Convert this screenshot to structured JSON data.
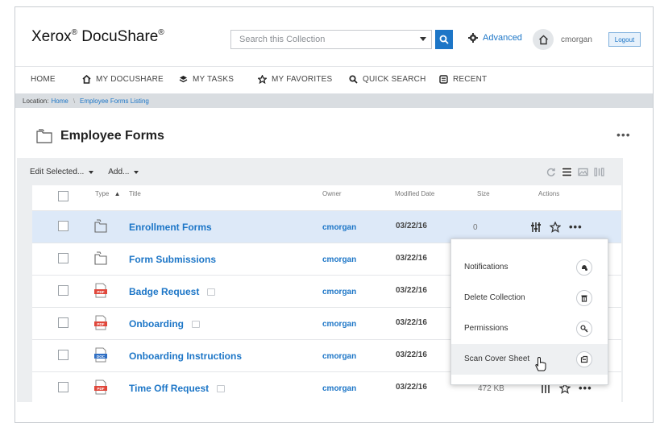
{
  "brand": {
    "name": "Xerox",
    "reg1": "®",
    "product": " DocuShare",
    "reg2": "®"
  },
  "search": {
    "placeholder": "Search this Collection",
    "advanced_label": "Advanced"
  },
  "user": {
    "name": "cmorgan",
    "logout_label": "Logout"
  },
  "nav": {
    "items": [
      {
        "label": "HOME",
        "icon": ""
      },
      {
        "label": "MY DOCUSHARE",
        "icon": "home-icon"
      },
      {
        "label": "MY TASKS",
        "icon": "layers-icon"
      },
      {
        "label": "MY FAVORITES",
        "icon": "star-icon"
      },
      {
        "label": "QUICK SEARCH",
        "icon": "search-icon"
      },
      {
        "label": "RECENT",
        "icon": "list-icon"
      }
    ]
  },
  "breadcrumb": {
    "prefix": "Location:",
    "home": "Home",
    "sep": "\\",
    "current": "Employee Forms Listing"
  },
  "page": {
    "title": "Employee Forms",
    "more": "•••"
  },
  "toolbar": {
    "edit_selected": "Edit Selected...",
    "add": "Add..."
  },
  "columns": {
    "type": "Type",
    "sort_arrow": "▲",
    "title": "Title",
    "owner": "Owner",
    "modified": "Modified Date",
    "size": "Size",
    "actions": "Actions"
  },
  "rows": [
    {
      "type": "folder",
      "title": "Enrollment Forms",
      "owner": "cmorgan",
      "date": "03/22/16",
      "size": "0",
      "copy": false,
      "selected": true
    },
    {
      "type": "folder",
      "title": "Form Submissions",
      "owner": "cmorgan",
      "date": "03/22/16",
      "size": "",
      "copy": false,
      "selected": false
    },
    {
      "type": "pdf",
      "title": "Badge Request",
      "owner": "cmorgan",
      "date": "03/22/16",
      "size": "",
      "copy": true,
      "selected": false
    },
    {
      "type": "pdf",
      "title": "Onboarding",
      "owner": "cmorgan",
      "date": "03/22/16",
      "size": "",
      "copy": true,
      "selected": false
    },
    {
      "type": "doc",
      "title": "Onboarding Instructions",
      "owner": "cmorgan",
      "date": "03/22/16",
      "size": "",
      "copy": false,
      "selected": false
    },
    {
      "type": "pdf",
      "title": "Time Off Request",
      "owner": "cmorgan",
      "date": "03/22/16",
      "size": "472 KB",
      "copy": true,
      "selected": false
    }
  ],
  "actions_menu": {
    "items": [
      {
        "label": "Notifications",
        "icon": "bell-icon"
      },
      {
        "label": "Delete Collection",
        "icon": "trash-icon"
      },
      {
        "label": "Permissions",
        "icon": "key-icon"
      },
      {
        "label": "Scan Cover Sheet",
        "icon": "scan-icon"
      }
    ]
  },
  "colors": {
    "accent": "#1d76c7",
    "selected_row": "#dde9f8",
    "pdf": "#e0473b",
    "doc": "#2f6fc4"
  }
}
